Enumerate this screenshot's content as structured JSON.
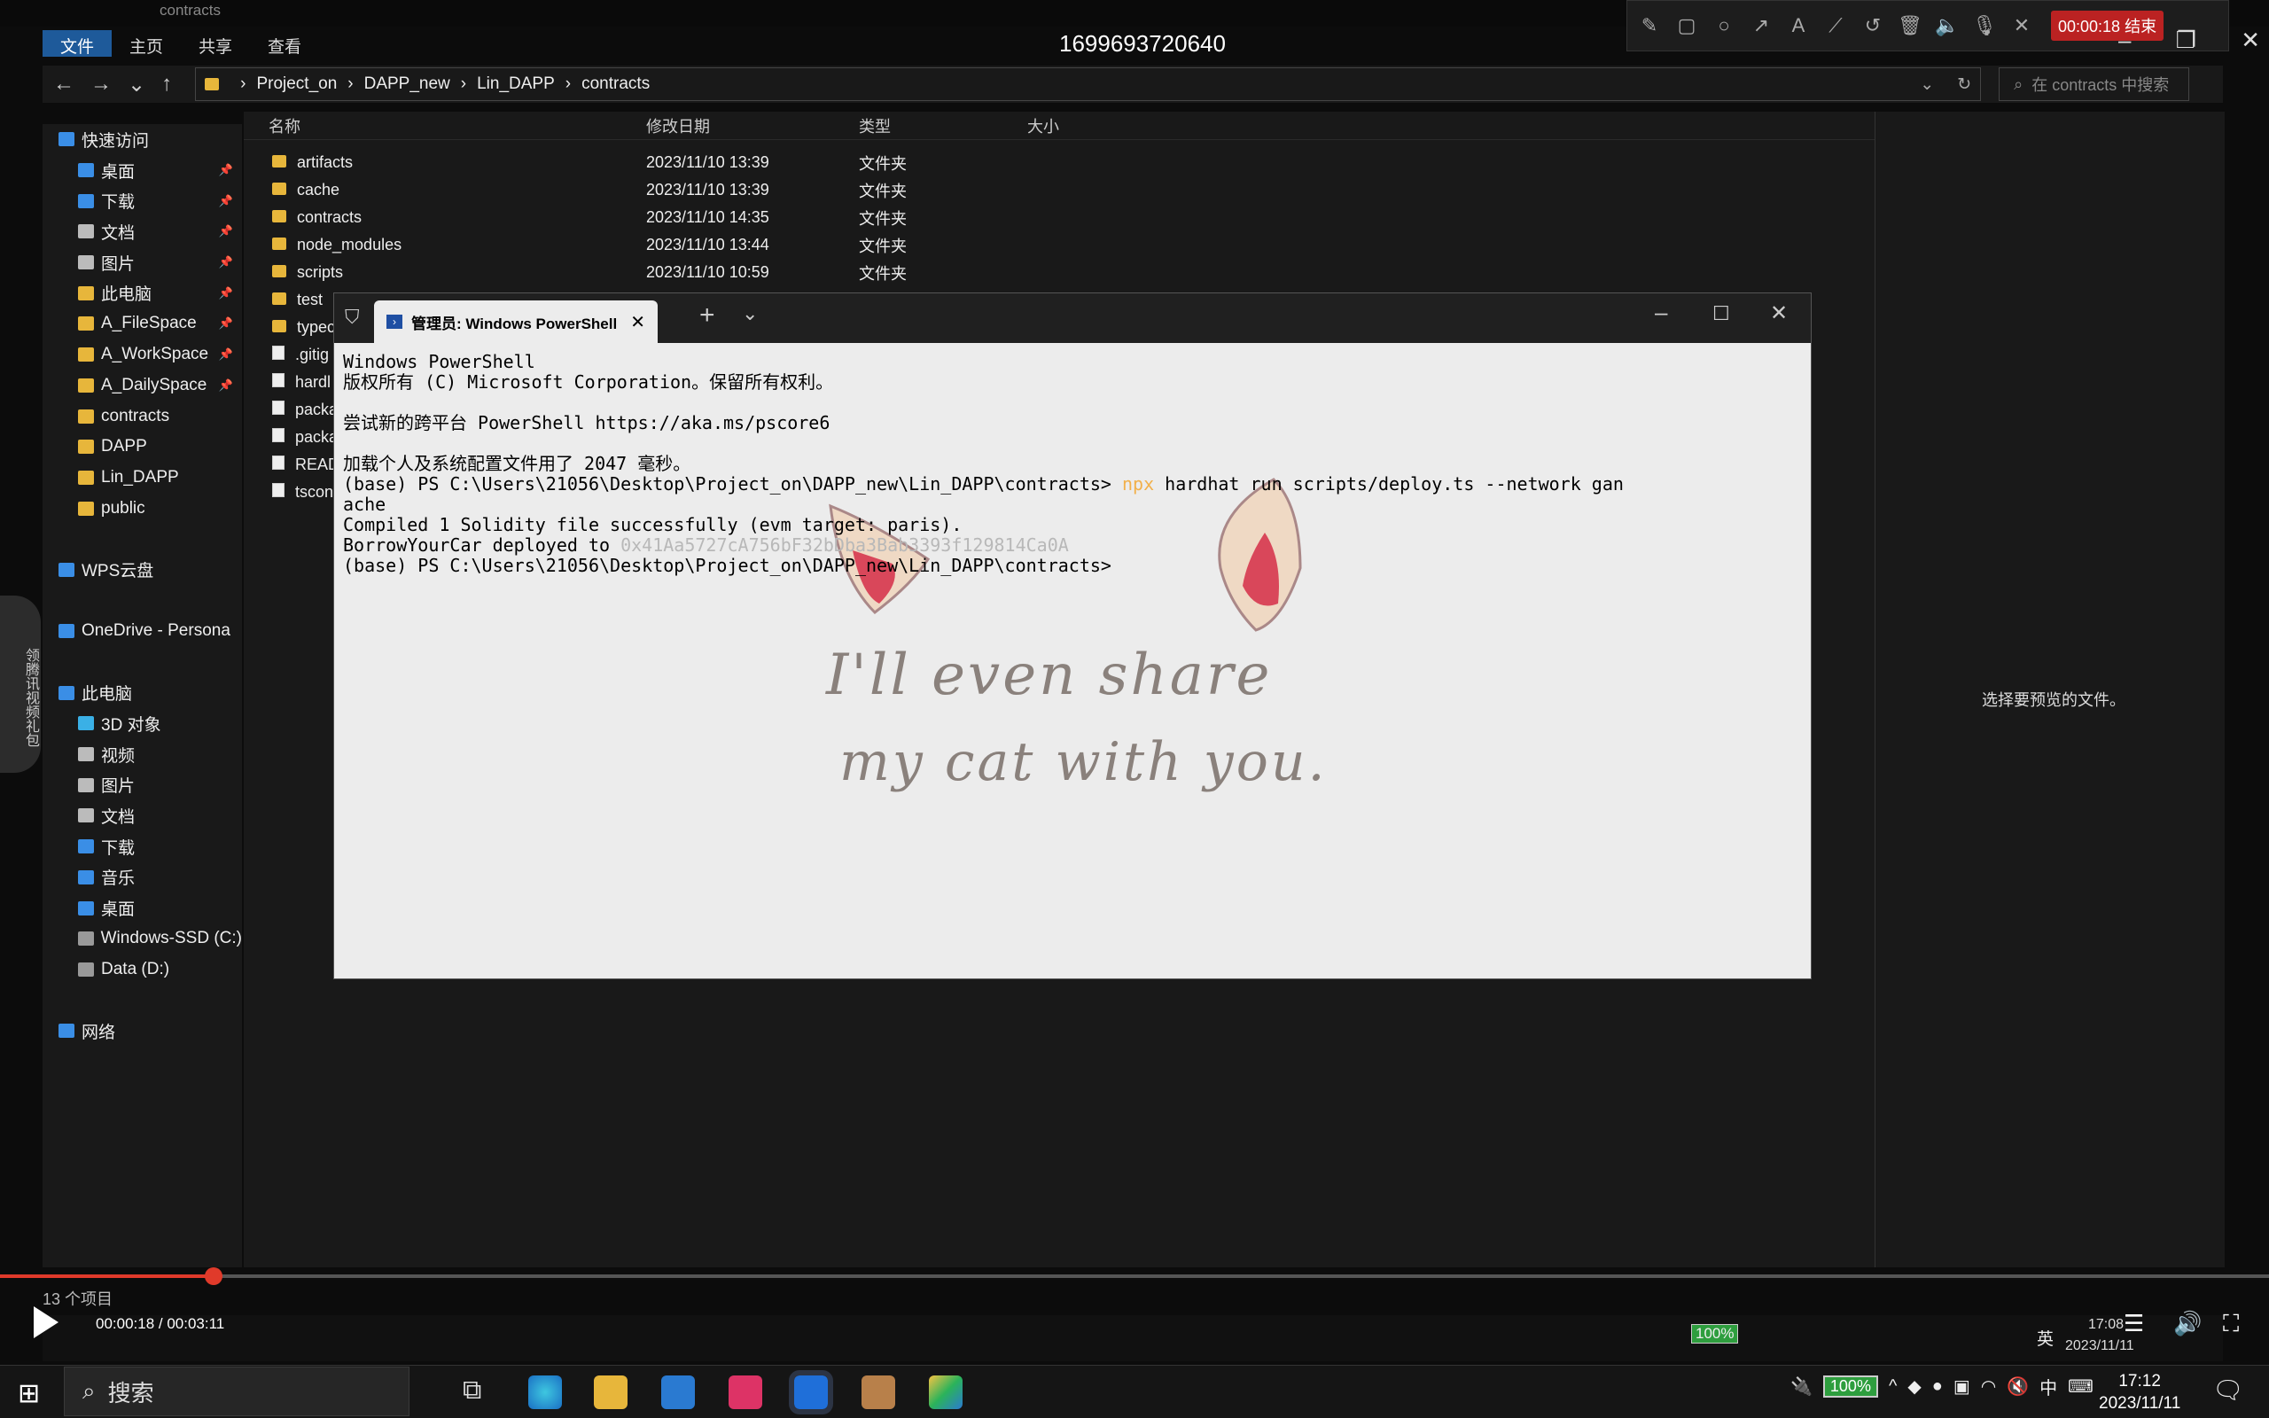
{
  "video": {
    "title": "1699693720640",
    "current_time": "00:00:18",
    "duration": "00:03:11",
    "time_display": "00:00:18 / 00:03:11",
    "progress": 0.094
  },
  "recording": {
    "badge": "00:00:18 结束"
  },
  "explorer": {
    "window_title": "contracts",
    "ribbon": {
      "file": "文件",
      "home": "主页",
      "share": "共享",
      "view": "查看"
    },
    "breadcrumb": [
      "Project_on",
      "DAPP_new",
      "Lin_DAPP",
      "contracts"
    ],
    "search_placeholder": "在 contracts 中搜索",
    "sidebar": [
      {
        "label": "快速访问",
        "icon": "star-icon",
        "pinned": false
      },
      {
        "label": "桌面",
        "icon": "desktop-icon",
        "pinned": true
      },
      {
        "label": "下载",
        "icon": "download-icon",
        "pinned": true
      },
      {
        "label": "文档",
        "icon": "document-icon",
        "pinned": true
      },
      {
        "label": "图片",
        "icon": "image-icon",
        "pinned": true
      },
      {
        "label": "此电脑",
        "icon": "folder-icon",
        "pinned": true
      },
      {
        "label": "A_FileSpace",
        "icon": "folder-icon",
        "pinned": true
      },
      {
        "label": "A_WorkSpace",
        "icon": "folder-icon",
        "pinned": true
      },
      {
        "label": "A_DailySpace",
        "icon": "folder-icon",
        "pinned": true
      },
      {
        "label": "contracts",
        "icon": "folder-icon",
        "pinned": false
      },
      {
        "label": "DAPP",
        "icon": "folder-icon",
        "pinned": false
      },
      {
        "label": "Lin_DAPP",
        "icon": "folder-icon",
        "pinned": false
      },
      {
        "label": "public",
        "icon": "folder-icon",
        "pinned": false
      },
      {
        "label": "",
        "icon": "",
        "pinned": false
      },
      {
        "label": "WPS云盘",
        "icon": "cloud-icon",
        "pinned": false
      },
      {
        "label": "",
        "icon": "",
        "pinned": false
      },
      {
        "label": "OneDrive - Persona",
        "icon": "cloud-icon",
        "pinned": false
      },
      {
        "label": "",
        "icon": "",
        "pinned": false
      },
      {
        "label": "此电脑",
        "icon": "computer-icon",
        "pinned": false
      },
      {
        "label": "3D 对象",
        "icon": "cube-icon",
        "pinned": false
      },
      {
        "label": "视频",
        "icon": "video-icon",
        "pinned": false
      },
      {
        "label": "图片",
        "icon": "image-icon",
        "pinned": false
      },
      {
        "label": "文档",
        "icon": "document-icon",
        "pinned": false
      },
      {
        "label": "下载",
        "icon": "download-icon",
        "pinned": false
      },
      {
        "label": "音乐",
        "icon": "music-icon",
        "pinned": false
      },
      {
        "label": "桌面",
        "icon": "desktop-icon",
        "pinned": false
      },
      {
        "label": "Windows-SSD (C:)",
        "icon": "drive-icon",
        "pinned": false
      },
      {
        "label": "Data (D:)",
        "icon": "drive-icon",
        "pinned": false
      },
      {
        "label": "",
        "icon": "",
        "pinned": false
      },
      {
        "label": "网络",
        "icon": "network-icon",
        "pinned": false
      }
    ],
    "columns": {
      "name": "名称",
      "date": "修改日期",
      "type": "类型",
      "size": "大小"
    },
    "files": [
      {
        "name": "artifacts",
        "date": "2023/11/10 13:39",
        "type": "文件夹",
        "kind": "folder"
      },
      {
        "name": "cache",
        "date": "2023/11/10 13:39",
        "type": "文件夹",
        "kind": "folder"
      },
      {
        "name": "contracts",
        "date": "2023/11/10 14:35",
        "type": "文件夹",
        "kind": "folder"
      },
      {
        "name": "node_modules",
        "date": "2023/11/10 13:44",
        "type": "文件夹",
        "kind": "folder"
      },
      {
        "name": "scripts",
        "date": "2023/11/10 10:59",
        "type": "文件夹",
        "kind": "folder"
      },
      {
        "name": "test",
        "date": "",
        "type": "",
        "kind": "folder"
      },
      {
        "name": "typec",
        "date": "",
        "type": "",
        "kind": "folder"
      },
      {
        "name": ".gitig",
        "date": "",
        "type": "",
        "kind": "file"
      },
      {
        "name": "hardl",
        "date": "",
        "type": "",
        "kind": "file"
      },
      {
        "name": "packa",
        "date": "",
        "type": "",
        "kind": "file"
      },
      {
        "name": "packa",
        "date": "",
        "type": "",
        "kind": "file"
      },
      {
        "name": "READ",
        "date": "",
        "type": "",
        "kind": "file"
      },
      {
        "name": "tscon",
        "date": "",
        "type": "",
        "kind": "file"
      }
    ],
    "status": "13 个项目",
    "preview_message": "选择要预览的文件。"
  },
  "powershell": {
    "tab_title": "管理员: Windows PowerShell",
    "lines": {
      "l1": "Windows PowerShell",
      "l2": "版权所有 (C) Microsoft Corporation。保留所有权利。",
      "l3": "尝试新的跨平台 PowerShell https://aka.ms/pscore6",
      "l4": "加载个人及系统配置文件用了 2047 毫秒。",
      "l5_prompt": "(base) PS C:\\Users\\21056\\Desktop\\Project_on\\DAPP_new\\Lin_DAPP\\contracts> ",
      "l5_cmd": "npx",
      "l5_rest": " hardhat run scripts/deploy.ts --network gan",
      "l6": "ache",
      "l7": "Compiled 1 Solidity file successfully (evm target: paris).",
      "l8_label": "BorrowYourCar deployed to ",
      "l8_addr": "0x41Aa5727cA756bF32bDba3Bab3393f129814Ca0A",
      "l9": "(base) PS C:\\Users\\21056\\Desktop\\Project_on\\DAPP_new\\Lin_DAPP\\contracts>"
    },
    "wallpaper_line1": "I'll even share",
    "wallpaper_line2": "my cat with you."
  },
  "left_banner": "领腾讯视频礼包",
  "taskbar": {
    "search": "搜索",
    "battery": "100%",
    "ime": "中",
    "ime_inner": "英",
    "time": "17:12",
    "date": "2023/11/11",
    "inner_time": "17:08",
    "inner_date": "2023/11/11"
  },
  "colors": {
    "accent": "#1e5a9a",
    "progress": "#e03a2a",
    "folder": "#e7b63b",
    "npx": "#f2b04a"
  }
}
